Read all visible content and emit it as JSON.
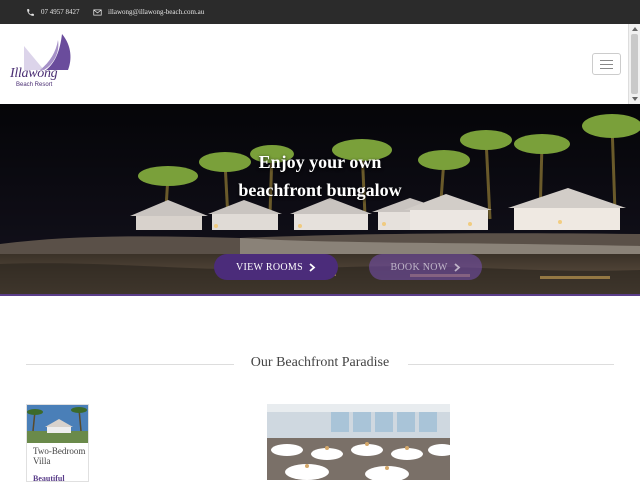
{
  "topbar": {
    "phone": "07 4957 8427",
    "email": "illawong@illawong-beach.com.au",
    "phone_icon": "phone-icon",
    "email_icon": "envelope-icon"
  },
  "logo": {
    "name": "Illawong",
    "tagline": "Beach Resort"
  },
  "hero": {
    "title_line1": "Enjoy your own",
    "title_line2": "beachfront bungalow",
    "btn_view": "VIEW ROOMS",
    "btn_book": "BOOK NOW"
  },
  "section": {
    "title": "Our Beachfront Paradise"
  },
  "cards": [
    {
      "caption_line1": "Two-Bedroom",
      "caption_line2": "Villa",
      "more": "Beautiful"
    }
  ],
  "colors": {
    "accent": "#4b2c7a",
    "topbar": "#2b2b2b"
  }
}
